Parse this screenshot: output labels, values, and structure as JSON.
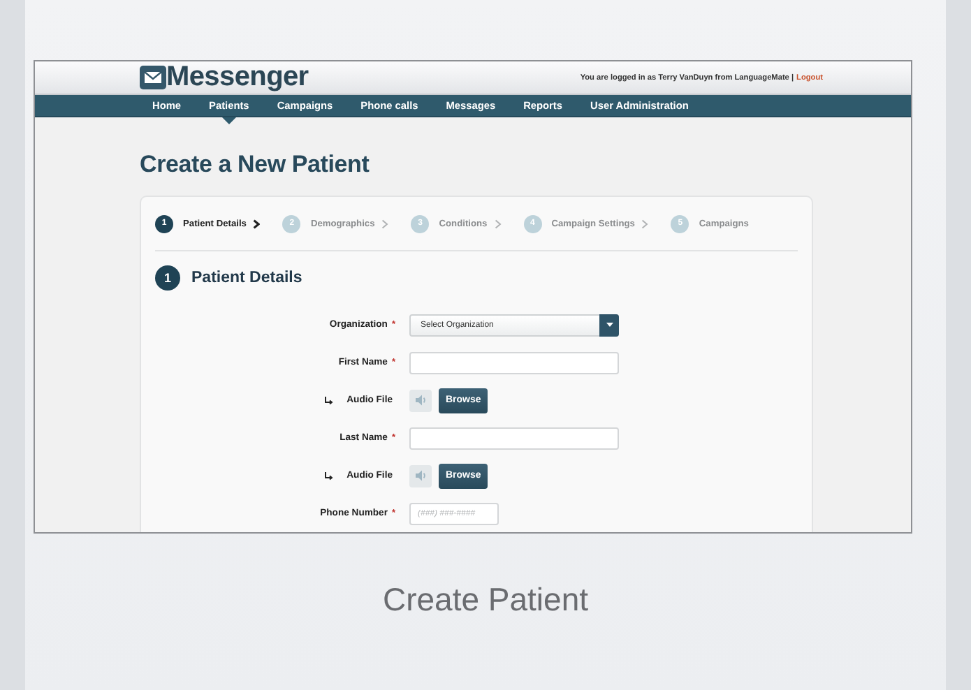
{
  "app": {
    "logo": "Messenger",
    "login_text": "You are logged in as Terry VanDuyn from LanguageMate |",
    "logout": "Logout"
  },
  "nav": [
    {
      "label": "Home",
      "selected": false
    },
    {
      "label": "Patients",
      "selected": true
    },
    {
      "label": "Campaigns",
      "selected": false
    },
    {
      "label": "Phone calls",
      "selected": false
    },
    {
      "label": "Messages",
      "selected": false
    },
    {
      "label": "Reports",
      "selected": false
    },
    {
      "label": "User Administration",
      "selected": false
    }
  ],
  "page_title": "Create a New Patient",
  "steps": [
    {
      "number": "1",
      "label": "Patient Details",
      "selected": true
    },
    {
      "number": "2",
      "label": "Demographics",
      "selected": false
    },
    {
      "number": "3",
      "label": "Conditions",
      "selected": false
    },
    {
      "number": "4",
      "label": "Campaign Settings",
      "selected": false
    },
    {
      "number": "5",
      "label": "Campaigns",
      "selected": false
    }
  ],
  "section": {
    "number": "1",
    "title": "Patient Details"
  },
  "fields": [
    {
      "kind": "select",
      "label": "Organization",
      "required_mark": "*",
      "value": "Select Organization"
    },
    {
      "kind": "text",
      "label": "First Name",
      "required_mark": "*"
    },
    {
      "kind": "audio",
      "label": "Audio File",
      "button": "Browse"
    },
    {
      "kind": "text",
      "label": "Last Name",
      "required_mark": "*"
    },
    {
      "kind": "audio",
      "label": "Audio File",
      "button": "Browse"
    },
    {
      "kind": "phone",
      "label": "Phone Number",
      "required_mark": "*",
      "placeholder": "(###) ###-####"
    }
  ],
  "caption": "Create Patient"
}
